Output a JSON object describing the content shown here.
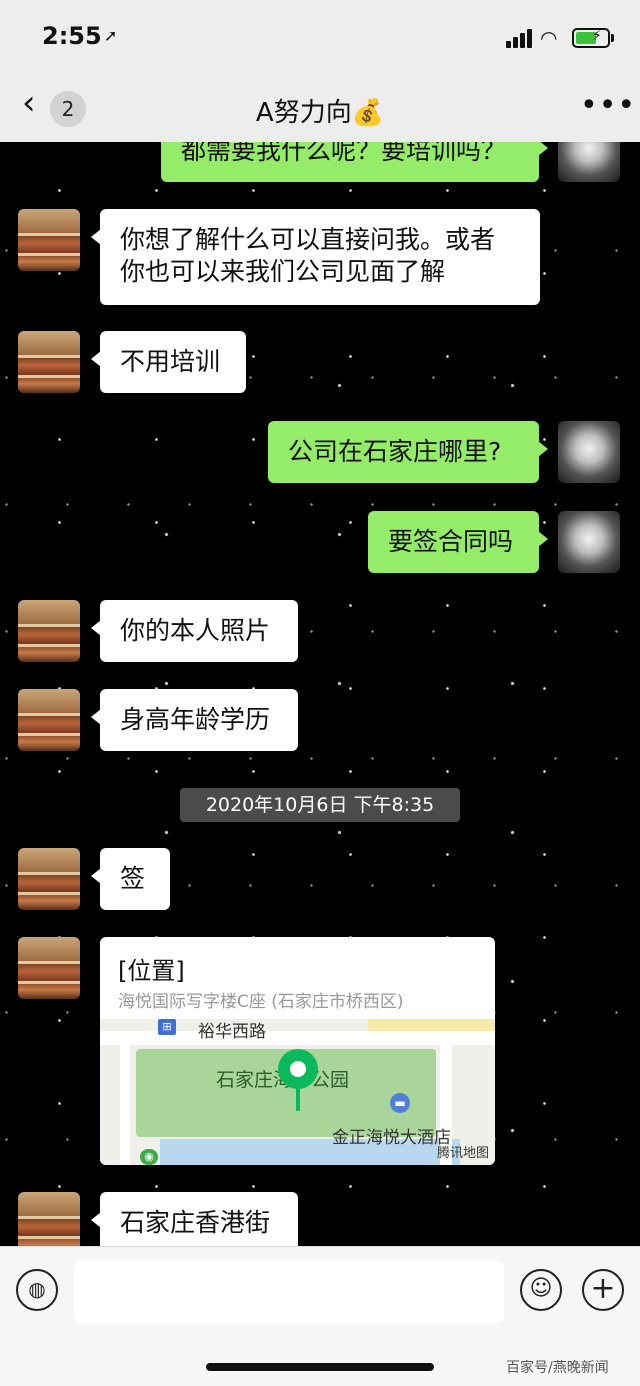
{
  "status": {
    "time": "2:55",
    "location_icon": "location-arrow-icon",
    "signal_icon": "signal-icon",
    "wifi_icon": "wifi-icon",
    "battery_icon": "battery-charging-icon"
  },
  "nav": {
    "back_icon": "chevron-left-icon",
    "unread": "2",
    "title": "A努力向💰",
    "more": "•••"
  },
  "messages": {
    "m0": "都需要我什么呢？要培训吗？",
    "m1_line1": "你想了解什么可以直接问我。或者",
    "m1_line2": "你也可以来我们公司见面了解",
    "m2": "不用培训",
    "m3": "公司在石家庄哪里?",
    "m4": "要签合同吗",
    "m5": "你的本人照片",
    "m6": "身高年龄学历",
    "timestamp": "2020年10月6日 下午8:35",
    "m7": "签",
    "m9": "石家庄香港街"
  },
  "location_card": {
    "title": "[位置]",
    "address": "海悦国际写字楼C座 (石家庄市桥西区)",
    "road_label": "裕华西路",
    "park_label": "石家庄海洋公园",
    "hotel_label": "金正海悦大酒店",
    "map_credit": "腾讯地图"
  },
  "input_bar": {
    "voice_icon": "voice-icon",
    "emoji_icon": "emoji-icon",
    "plus_icon": "plus-icon"
  },
  "watermark": "百家号/燕晚新闻"
}
